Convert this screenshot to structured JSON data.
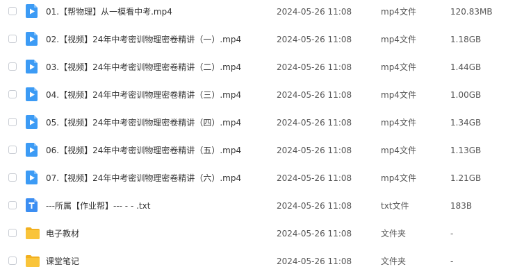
{
  "files": [
    {
      "name": "01.【帮物理】从一模看中考.mp4",
      "date": "2024-05-26 11:08",
      "type": "mp4文件",
      "size": "120.83MB",
      "icon": "video-file-icon"
    },
    {
      "name": "02.【视频】24年中考密训物理密卷精讲（一）.mp4",
      "date": "2024-05-26 11:08",
      "type": "mp4文件",
      "size": "1.18GB",
      "icon": "video-file-icon"
    },
    {
      "name": "03.【视频】24年中考密训物理密卷精讲（二）.mp4",
      "date": "2024-05-26 11:08",
      "type": "mp4文件",
      "size": "1.44GB",
      "icon": "video-file-icon"
    },
    {
      "name": "04.【视频】24年中考密训物理密卷精讲（三）.mp4",
      "date": "2024-05-26 11:08",
      "type": "mp4文件",
      "size": "1.00GB",
      "icon": "video-file-icon"
    },
    {
      "name": "05.【视频】24年中考密训物理密卷精讲（四）.mp4",
      "date": "2024-05-26 11:08",
      "type": "mp4文件",
      "size": "1.34GB",
      "icon": "video-file-icon"
    },
    {
      "name": "06.【视频】24年中考密训物理密卷精讲（五）.mp4",
      "date": "2024-05-26 11:08",
      "type": "mp4文件",
      "size": "1.13GB",
      "icon": "video-file-icon"
    },
    {
      "name": "07.【视频】24年中考密训物理密卷精讲（六）.mp4",
      "date": "2024-05-26 11:08",
      "type": "mp4文件",
      "size": "1.21GB",
      "icon": "video-file-icon"
    },
    {
      "name": "---所属【作业帮】--- - - .txt",
      "date": "2024-05-26 11:08",
      "type": "txt文件",
      "size": "183B",
      "icon": "text-file-icon"
    },
    {
      "name": "电子教材",
      "date": "2024-05-26 11:08",
      "type": "文件夹",
      "size": "-",
      "icon": "folder-icon"
    },
    {
      "name": "课堂笔记",
      "date": "2024-05-26 11:08",
      "type": "文件夹",
      "size": "-",
      "icon": "folder-icon"
    }
  ],
  "colors": {
    "video_icon": "#3c9bf5",
    "text_icon": "#3c8ef2",
    "folder_icon": "#f9c43a",
    "folder_tab": "#f2b01f",
    "checkbox_border": "#c8ccd3",
    "text_primary": "#333333",
    "text_secondary": "#555555"
  }
}
